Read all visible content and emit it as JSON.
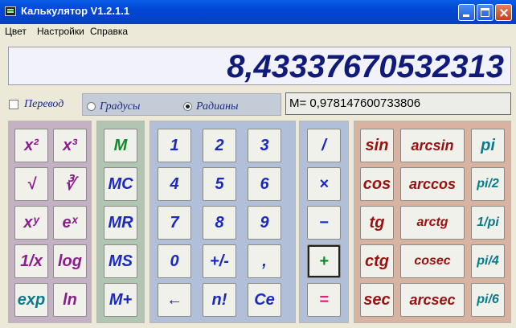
{
  "window": {
    "title": "Калькулятор V1.2.1.1"
  },
  "menu": [
    "Цвет",
    "Настройки",
    "Справка"
  ],
  "display": {
    "value": "8,43337670532313"
  },
  "options": {
    "perevod_label": "Перевод",
    "gradusy_label": "Градусы",
    "radiany_label": "Радианы",
    "selected_mode": "Радианы"
  },
  "memory": {
    "text": "M= 0,978147600733806"
  },
  "colors": {
    "panel_purple": "#c4b2c4",
    "panel_green": "#b2c4b2",
    "panel_blue": "#b2bfd9",
    "panel_orange": "#d9b3a1",
    "text_purple": "#8a1f8a",
    "text_teal": "#0b7a8a",
    "text_blue": "#1a2ac0",
    "text_green": "#118a2a",
    "text_red": "#9a1010",
    "display_text": "#0f1a7a"
  },
  "buttons": {
    "powers": [
      "x²",
      "x³",
      "√",
      "∛",
      "xʸ",
      "eˣ",
      "1/x",
      "log",
      "exp",
      "ln"
    ],
    "memory": [
      "M",
      "MC",
      "MR",
      "MS",
      "M+"
    ],
    "digits": [
      "1",
      "2",
      "3",
      "4",
      "5",
      "6",
      "7",
      "8",
      "9",
      "0",
      "+/-",
      ",",
      "←",
      "n!",
      "Ce"
    ],
    "ops": [
      "/",
      "×",
      "−",
      "+",
      "="
    ],
    "trig": [
      "sin",
      "arcsin",
      "pi",
      "cos",
      "arccos",
      "pi/2",
      "tg",
      "arctg",
      "1/pi",
      "ctg",
      "cosec",
      "pi/4",
      "sec",
      "arcsec",
      "pi/6"
    ]
  }
}
